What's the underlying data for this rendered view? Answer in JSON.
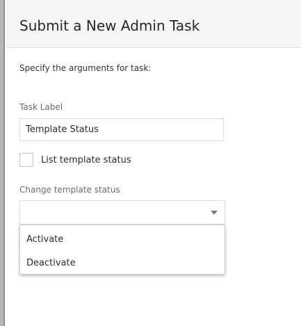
{
  "dialog": {
    "title": "Submit a New Admin Task",
    "instructions": "Specify the arguments for task:"
  },
  "form": {
    "task_label": {
      "caption": "Task Label",
      "value": "Template Status"
    },
    "list_template_status": {
      "label": "List template status",
      "checked": false
    },
    "change_template_status": {
      "caption": "Change template status",
      "selected": "",
      "options": [
        "Activate",
        "Deactivate"
      ]
    }
  },
  "icons": {
    "dropdown": "chevron-down-icon"
  },
  "colors": {
    "header_bg": "#f5f5f5",
    "border": "#dfdfdf",
    "caption_text": "#6a6a6a",
    "text": "#2b2b2b"
  }
}
